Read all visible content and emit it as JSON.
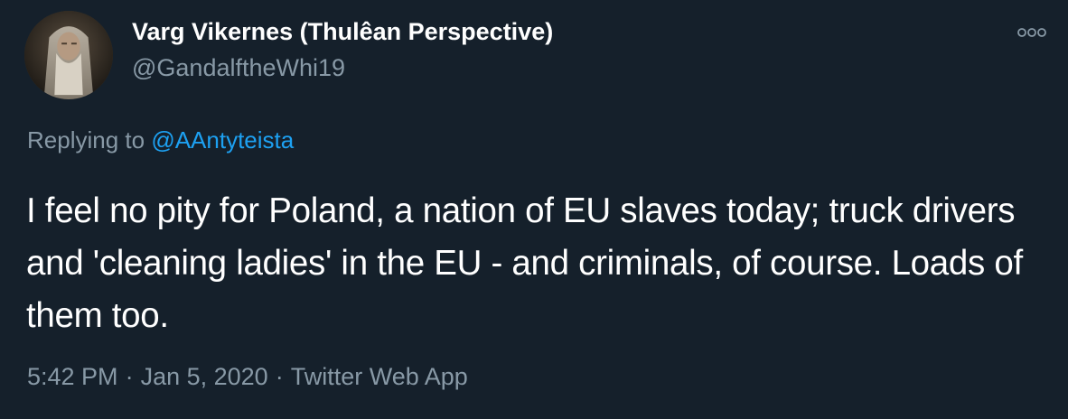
{
  "tweet": {
    "author": {
      "display_name": "Varg Vikernes (Thulêan Perspective)",
      "handle": "@GandalftheWhi19",
      "avatar_icon": "profile-photo"
    },
    "more_icon": "more-horizontal-icon",
    "reply": {
      "prefix": "Replying to ",
      "target": "@AAntyteista"
    },
    "text": "I feel no pity for Poland, a nation of EU slaves today; truck drivers and 'cleaning ladies' in the EU - and criminals, of course. Loads of them too.",
    "meta": {
      "time": "5:42 PM",
      "separator": "·",
      "date": "Jan 5, 2020",
      "source": "Twitter Web App"
    },
    "colors": {
      "background": "#15202b",
      "primary_text": "#ffffff",
      "secondary_text": "#8899a6",
      "link": "#1da1f2"
    }
  }
}
